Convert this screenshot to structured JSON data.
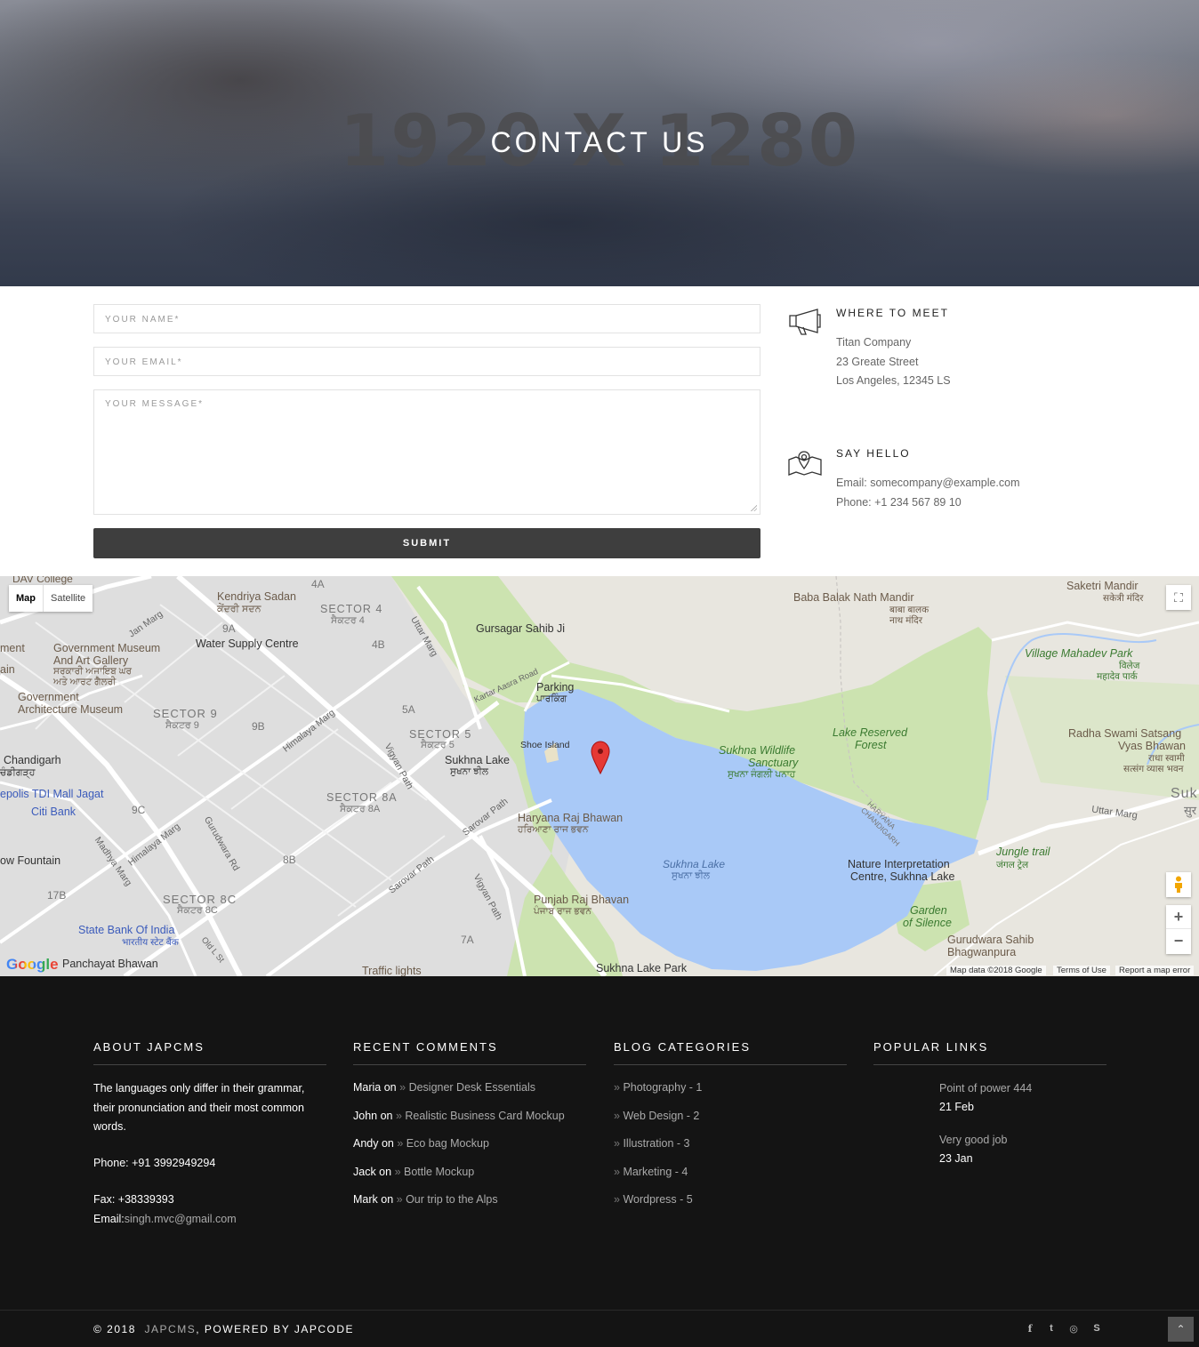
{
  "hero": {
    "watermark": "1920 X 1280",
    "title": "CONTACT US"
  },
  "form": {
    "name_placeholder": "YOUR NAME*",
    "email_placeholder": "YOUR EMAIL*",
    "message_placeholder": "YOUR MESSAGE*",
    "submit_label": "SUBMIT"
  },
  "where_to_meet": {
    "title": "WHERE TO MEET",
    "icon": "megaphone-icon",
    "lines": [
      "Titan Company",
      "23 Greate Street",
      "Los Angeles, 12345 LS"
    ]
  },
  "say_hello": {
    "title": "SAY HELLO",
    "icon": "map-pin-icon",
    "email": "Email: somecompany@example.com",
    "phone": "Phone: +1 234 567 89 10"
  },
  "map": {
    "type_buttons": [
      "Map",
      "Satellite"
    ],
    "labels": {
      "kendriya": "Kendriya Sadan",
      "kendriya_pa": "ਕੇਂਦਰੀ ਸਦਨ",
      "sector4": "SECTOR 4",
      "sector4_pa": "ਸੈਕਟਰ 4",
      "water": "Water Supply Centre",
      "govmuseum": "Government Museum",
      "artgallery": "And Art Gallery",
      "govmuseum_pa1": "ਸਰਕਾਰੀ ਅਜਾਇਬ ਘਰ",
      "govmuseum_pa2": "ਅਤੇ ਆਰਟ ਗੈਲਰੀ",
      "gov2": "Government",
      "archmuseum": "Architecture Museum",
      "sector9": "SECTOR 9",
      "sector9_pa": "ਸੈਕਟਰ 9",
      "sector5": "SECTOR 5",
      "sector5_pa": "ਸੈਕਟਰ 5",
      "sector8a": "SECTOR 8A",
      "sector8a_pa": "ਸੈਕਟਰ 8A",
      "sector8c": "SECTOR 8C",
      "sector8c_pa": "ਸੈਕਟਰ 8C",
      "chandigarh": "Chandigarh",
      "chandigarh_pa": "ਚੰਡੀਗੜ੍ਹ",
      "tdi": "epolis TDI Mall Jagat",
      "citibank": "Citi Bank",
      "fountain": "ow Fountain",
      "sbi": "State Bank Of India",
      "sbi_hi": "भारतीय स्टेट बैंक",
      "panchayat": "Panchayat Bhawan",
      "traffic": "Traffic lights",
      "gursagar": "Gursagar Sahib Ji",
      "parking": "Parking",
      "parking_pa": "ਪਾਰਕਿੰਗ",
      "shoe": "Shoe Island",
      "sukhna": "Sukhna Lake",
      "sukhna_pa": "ਸੁਖਨਾ ਝੀਲ",
      "haryana": "Haryana Raj Bhawan",
      "haryana_pa": "ਹਰਿਆਣਾ ਰਾਜ ਭਵਨ",
      "punjab": "Punjab Raj Bhavan",
      "punjab_pa": "ਪੰਜਾਬ ਰਾਜ ਭਵਨ",
      "lakecenter": "Sukhna Lake",
      "lakecenter_pa": "ਸੁਖਨਾ ਝੀਲ",
      "wildlife1": "Sukhna Wildlife",
      "wildlife2": "Sanctuary",
      "wildlife_pa": "ਸੁਖਨਾ ਜੰਗਲੀ ਪਨਾਹ",
      "reserved1": "Lake Reserved",
      "reserved2": "Forest",
      "baba": "Baba Balak Nath Mandir",
      "baba_hi1": "बाबा बालक",
      "baba_hi2": "नाथ मंदिर",
      "saketri": "Saketri Mandir",
      "saketri_hi": "सकेत्री मंदिर",
      "village": "Village Mahadev Park",
      "village_hi1": "विलेज",
      "village_hi2": "महादेव पार्क",
      "radha1": "Radha Swami Satsang",
      "radha2": "Vyas Bhawan",
      "radha_hi1": "राधा स्वामी",
      "radha_hi2": "सत्संग व्यास भवन",
      "uttarmarg": "Uttar Marg",
      "uttarmarg2": "Uttar Marg",
      "jungle": "Jungle trail",
      "jungle_hi": "जंगल ट्रेल",
      "nature1": "Nature Interpretation",
      "nature2": "Centre, Sukhna Lake",
      "garden1": "Garden",
      "garden2": "of Silence",
      "gurudwara1": "Gurudwara Sahib",
      "gurudwara2": "Bhagwanpura",
      "sukhnapark": "Sukhna Lake Park",
      "himalaya": "Himalaya Marg",
      "himalaya2": "Himalaya Marg",
      "vigyan": "Vigyan Path",
      "vigyan2": "Vigyan Path",
      "sarovar": "Sarovar Path",
      "sarovar2": "Sarovar Path",
      "kartar": "Kartar Aasra Road",
      "janmarg": "Jan Marg",
      "madhya": "Madhya Marg",
      "gurudwara_rd": "Gurudwara Rd",
      "haryana_chd": "HARYANA CHANDIGARH",
      "s9a": "9A",
      "s9b": "9B",
      "s9c": "9C",
      "s8b": "8B",
      "s4a": "4A",
      "s4b": "4B",
      "s5a": "5A",
      "s7a": "7A",
      "s17b": "17B",
      "dav": "DAV College",
      "ment": "ment",
      "ain": "ain",
      "suk": "Suk",
      "suk_hi": "सुर",
      "oldst": "Old L St"
    },
    "attribution": {
      "data": "Map data ©2018 Google",
      "terms": "Terms of Use",
      "report": "Report a map error",
      "logo": "Google"
    },
    "controls": {
      "zoom_in": "+",
      "zoom_out": "−"
    }
  },
  "footer": {
    "about": {
      "title": "ABOUT JAPCMS",
      "text": "The languages only differ in their grammar, their pronunciation and their most common words.",
      "phone": "Phone: +91 3992949294",
      "fax": "Fax: +38339393",
      "email_label": "Email:",
      "email": "singh.mvc@gmail.com"
    },
    "recent_comments": {
      "title": "RECENT COMMENTS",
      "items": [
        {
          "author": "Maria on",
          "post": "Designer Desk Essentials"
        },
        {
          "author": "John on",
          "post": "Realistic Business Card Mockup"
        },
        {
          "author": "Andy on",
          "post": "Eco bag Mockup"
        },
        {
          "author": "Jack on",
          "post": "Bottle Mockup"
        },
        {
          "author": "Mark on",
          "post": "Our trip to the Alps"
        }
      ]
    },
    "blog_categories": {
      "title": "BLOG CATEGORIES",
      "items": [
        "Photography - 1",
        "Web Design - 2",
        "Illustration - 3",
        "Marketing - 4",
        "Wordpress - 5"
      ]
    },
    "popular_links": {
      "title": "POPULAR LINKS",
      "items": [
        {
          "title": "Point of power 444",
          "date": "21 Feb"
        },
        {
          "title": "Very good job",
          "date": "23 Jan"
        }
      ]
    },
    "copyright_prefix": "© 2018",
    "copyright_brand": "JAPCMS",
    "copyright_suffix": ", POWERED BY JAPCODE",
    "social_icons": [
      "facebook-icon",
      "twitter-icon",
      "dribbble-icon",
      "skype-icon"
    ],
    "social_glyphs": [
      "f",
      "t",
      "◎",
      "S"
    ],
    "scroll_top_glyph": "⌃"
  }
}
